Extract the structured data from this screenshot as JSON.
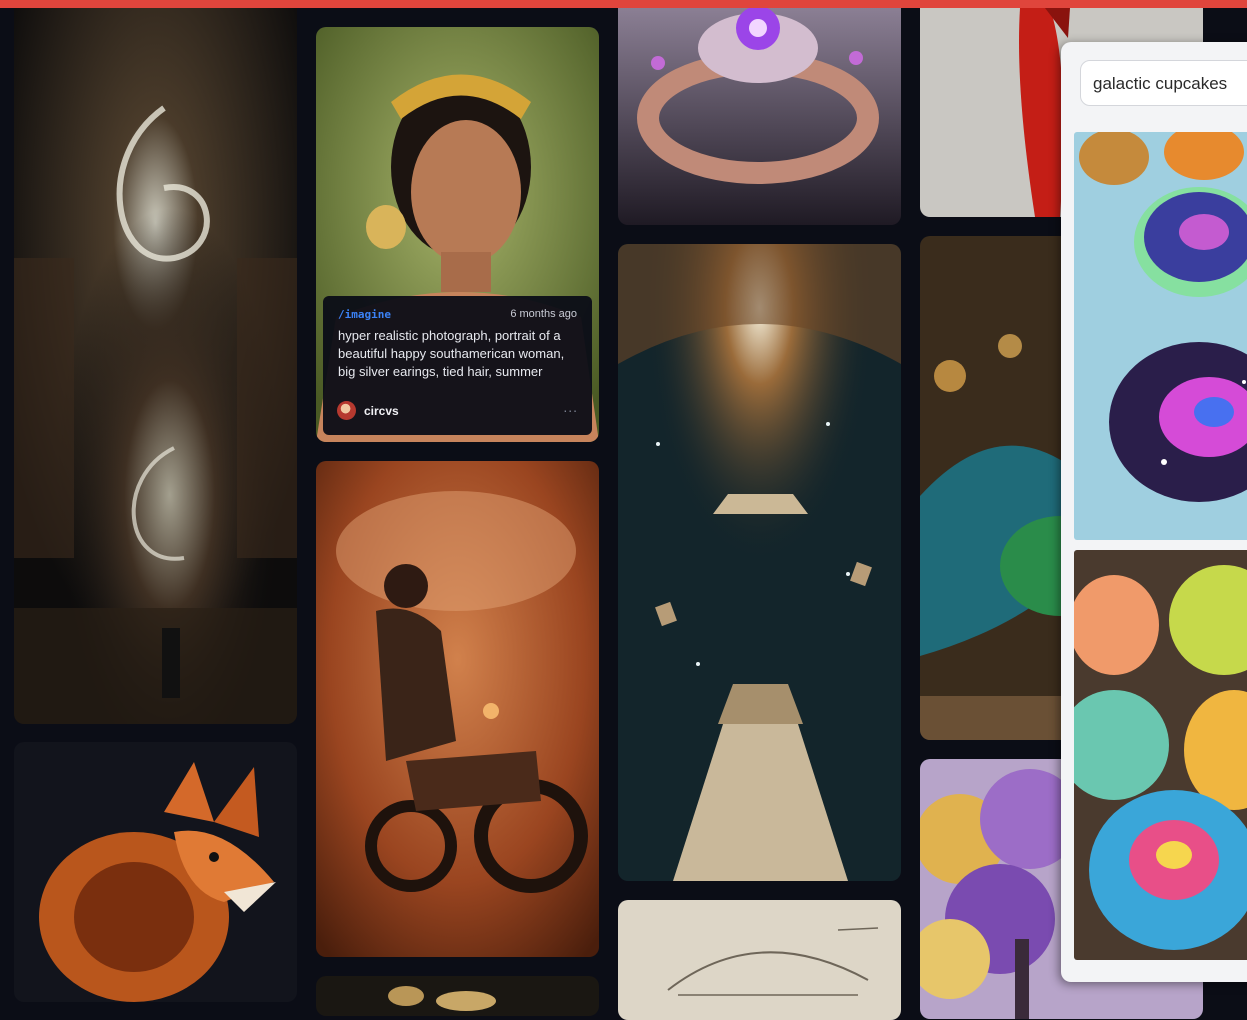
{
  "gallery": {
    "featured_caption": {
      "command": "/imagine",
      "time_ago": "6 months ago",
      "prompt": "hyper realistic photograph, portrait of a beautiful happy southamerican woman, big silver earings, tied hair, summer",
      "username": "circvs",
      "more_label": "..."
    },
    "tiles": [
      {
        "subject": "spiral library staircase"
      },
      {
        "subject": "ornate orange fox"
      },
      {
        "subject": "portrait of woman with golden headband"
      },
      {
        "subject": "motorcycle rider in red dust"
      },
      {
        "subject": "ornate ring with purple gems"
      },
      {
        "subject": "cosmic library with tower of books"
      },
      {
        "subject": "sketch of vehicle"
      },
      {
        "subject": "red paint figure"
      },
      {
        "subject": "teal scaled dragon eye"
      },
      {
        "subject": "purple and gold trees"
      }
    ]
  },
  "search": {
    "query": "galactic cupcakes",
    "results": [
      {
        "subject": "galaxy frosted cupcakes"
      },
      {
        "subject": "rainbow swirl cupcakes"
      }
    ]
  },
  "colors": {
    "background": "#0b0d16",
    "accent_bar": "#e0453c",
    "command_blue": "#3b82f6"
  }
}
